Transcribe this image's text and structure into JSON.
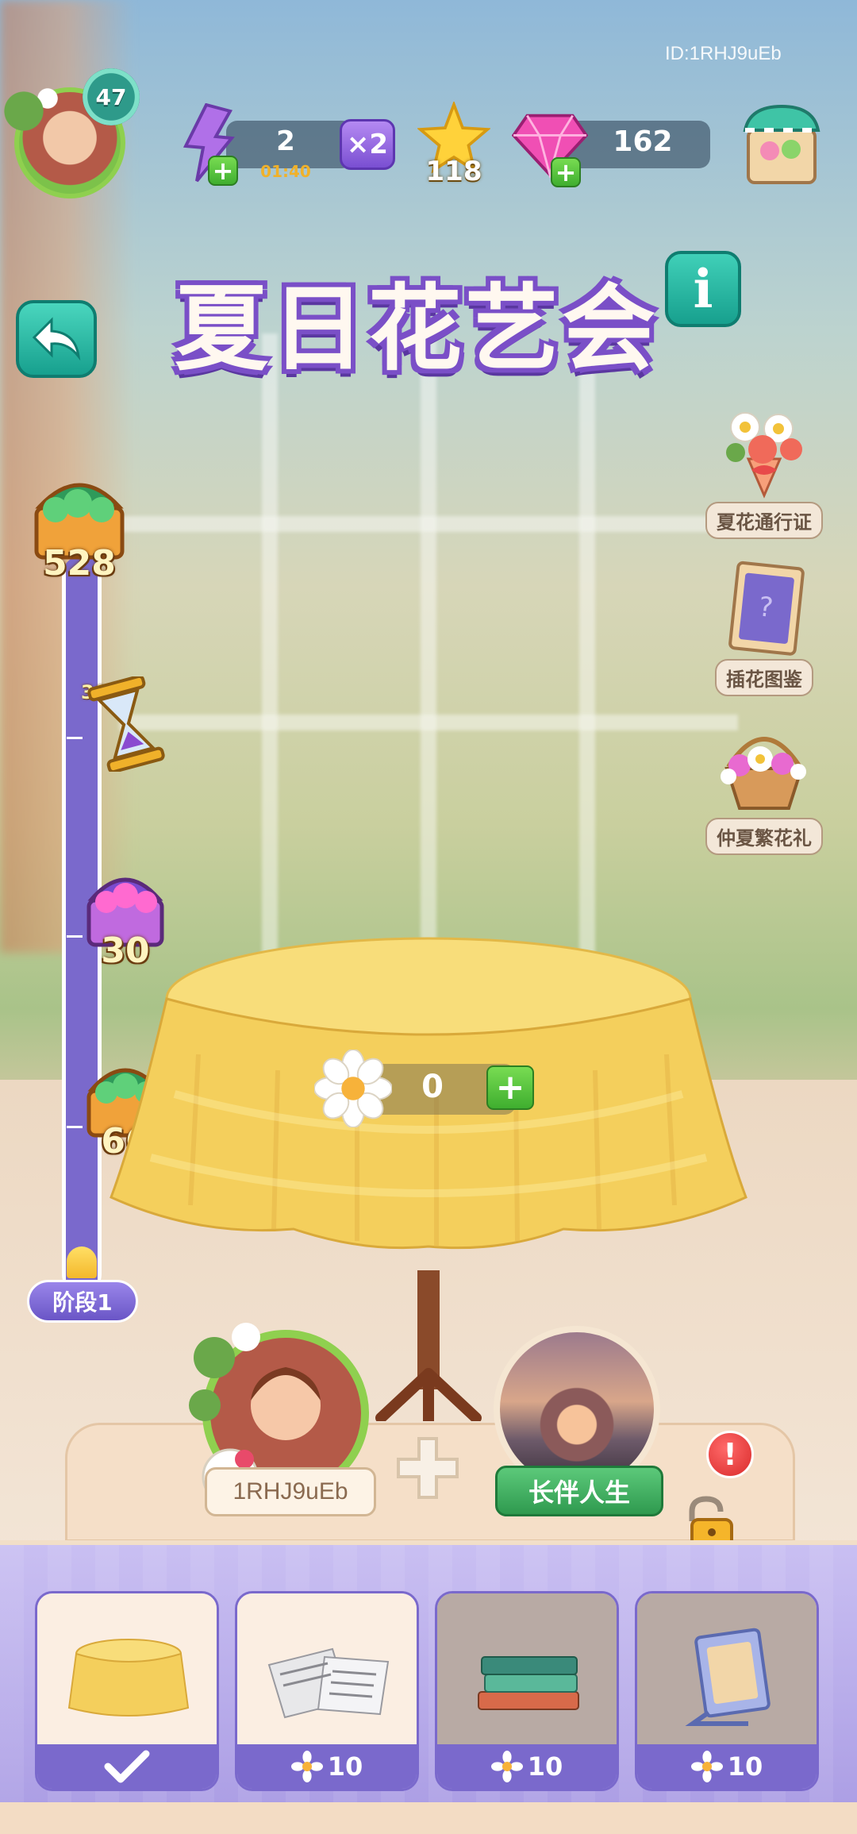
{
  "player_id_label": "ID:1RHJ9uEb",
  "hud": {
    "level": "47",
    "energy": "2",
    "energy_timer": "01:40",
    "multiplier": "×2",
    "stars": "118",
    "gems": "162",
    "plus": "+"
  },
  "event": {
    "title": "夏日花艺会",
    "info_icon_text": "i"
  },
  "progress": {
    "rewards": [
      {
        "value": "528",
        "icon": "green-gem-chest-icon"
      },
      {
        "value": "30分",
        "icon": "hourglass-icon"
      },
      {
        "value": "30",
        "icon": "pink-gem-chest-icon"
      },
      {
        "value": "66",
        "icon": "green-gem-chest-icon"
      }
    ],
    "stage_label": "阶段1",
    "fill_fraction": 0.03
  },
  "side_menu": [
    {
      "label": "夏花通行证",
      "icon": "bouquet-icon"
    },
    {
      "label": "插花图鉴",
      "icon": "album-icon"
    },
    {
      "label": "仲夏繁花礼",
      "icon": "flower-basket-icon"
    }
  ],
  "flower_counter": {
    "value": "0",
    "plus": "+"
  },
  "profile": {
    "player_name": "1RHJ9uEb",
    "partner_name": "长伴人生",
    "alert": "!"
  },
  "cards": [
    {
      "item": "tablecloth",
      "state": "selected",
      "cost": ""
    },
    {
      "item": "newspaper",
      "state": "open",
      "cost": "10"
    },
    {
      "item": "books",
      "state": "locked",
      "cost": "10"
    },
    {
      "item": "picture-frame",
      "state": "locked",
      "cost": "10"
    }
  ],
  "colors": {
    "accent_purple": "#7a69cc",
    "teal_button": "#17a08e",
    "green_plus": "#3fae2f"
  }
}
